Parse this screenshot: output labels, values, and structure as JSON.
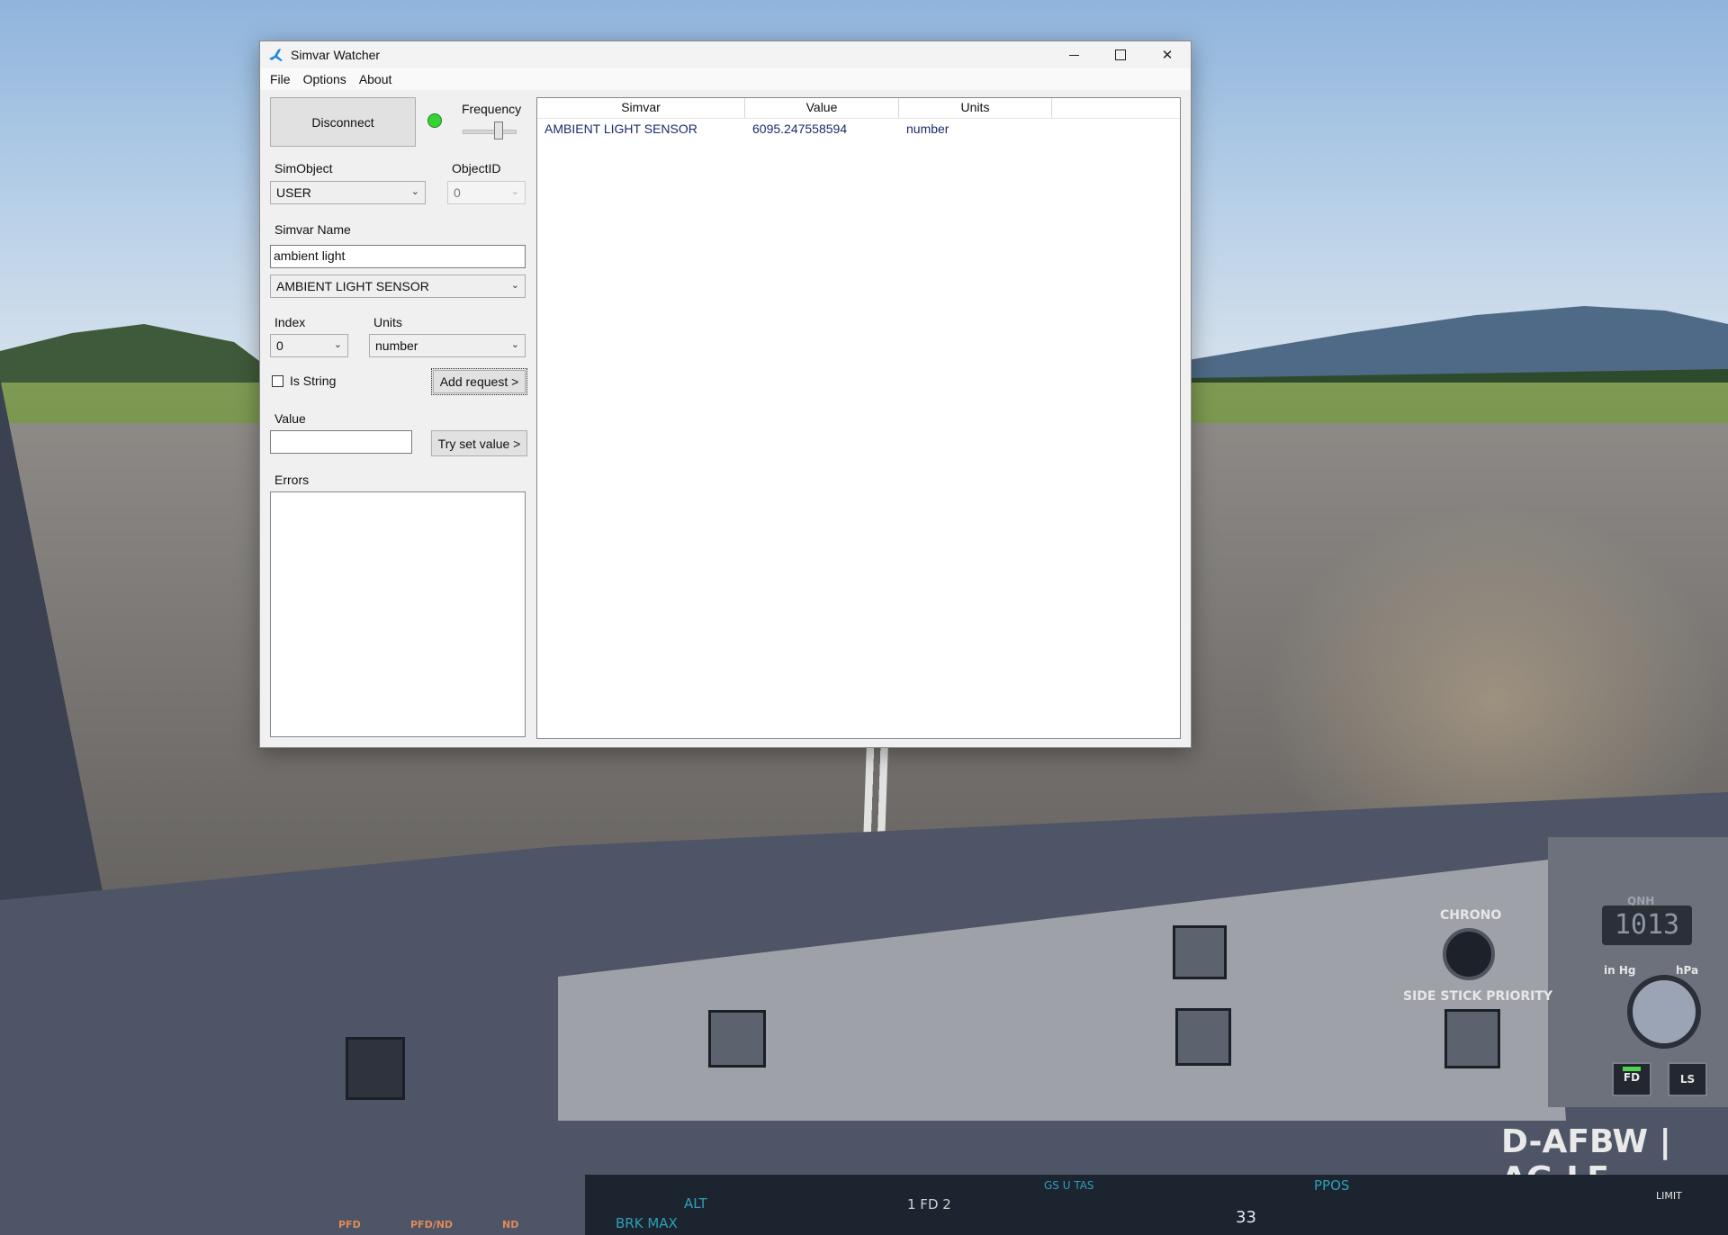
{
  "window": {
    "title": "Simvar Watcher",
    "controls": {
      "minimize": "—",
      "maximize": "☐",
      "close": "✕"
    }
  },
  "menu": {
    "file": "File",
    "options": "Options",
    "about": "About"
  },
  "connection": {
    "button_label": "Disconnect",
    "status_color": "#35d435",
    "frequency_label": "Frequency",
    "frequency_level": 0.7
  },
  "simobject": {
    "label": "SimObject",
    "value": "USER"
  },
  "objectid": {
    "label": "ObjectID",
    "value": "0"
  },
  "simvar_name": {
    "label": "Simvar Name",
    "input_value": "ambient light",
    "selected": "AMBIENT LIGHT SENSOR"
  },
  "index": {
    "label": "Index",
    "value": "0"
  },
  "units": {
    "label": "Units",
    "value": "number"
  },
  "is_string": {
    "label": "Is String",
    "checked": false
  },
  "add_request": {
    "label": "Add request >"
  },
  "value": {
    "label": "Value",
    "input_value": ""
  },
  "try_set": {
    "label": "Try set value >"
  },
  "errors": {
    "label": "Errors",
    "text": ""
  },
  "grid": {
    "columns": [
      "Simvar",
      "Value",
      "Units"
    ],
    "rows": [
      [
        "AMBIENT LIGHT SENSOR",
        "6095.247558594",
        "number"
      ]
    ]
  },
  "cockpit": {
    "chrono": "CHRONO",
    "side_stick": "SIDE STICK PRIORITY",
    "qnh_title": "QNH",
    "qnh_value": "1013",
    "in_hg": "in Hg",
    "hpa": "hPa",
    "fd": "FD",
    "ls": "LS",
    "registration": "D-AFBW | AG-LF",
    "pfd": "PFD",
    "pfd_nd": "PFD/ND",
    "nd": "ND",
    "brk_max": "BRK MAX",
    "alt": "ALT",
    "fd_mode": "1 FD 2",
    "gs_tas": "GS   U TAS",
    "ppos": "PPOS",
    "hdg": "33",
    "limit": "LIMIT"
  }
}
